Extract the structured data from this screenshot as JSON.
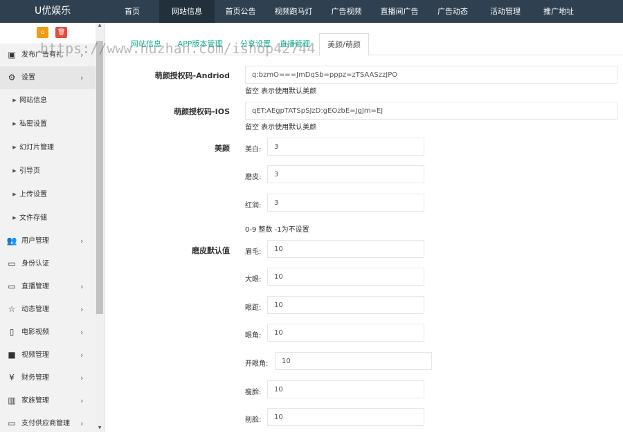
{
  "header": {
    "brand": "U优娱乐",
    "nav": [
      "首页",
      "网站信息",
      "首页公告",
      "视频跑马灯",
      "广告视频",
      "直播间广告",
      "广告动态",
      "活动管理",
      "推广地址"
    ]
  },
  "sidebar": {
    "items": [
      {
        "label": "发布广告有礼",
        "icon": "camera-icon",
        "glyph": "▣",
        "arrow": "›"
      },
      {
        "label": "设置",
        "icon": "gears-icon",
        "glyph": "⚙",
        "arrow": "›"
      },
      {
        "label": "网站信息",
        "icon": "caret-right-icon",
        "glyph": "▶"
      },
      {
        "label": "私密设置",
        "icon": "caret-right-icon",
        "glyph": "▶"
      },
      {
        "label": "幻灯片管理",
        "icon": "caret-right-icon",
        "glyph": "▶"
      },
      {
        "label": "引导页",
        "icon": "caret-right-icon",
        "glyph": "▶"
      },
      {
        "label": "上传设置",
        "icon": "caret-right-icon",
        "glyph": "▶"
      },
      {
        "label": "文件存储",
        "icon": "caret-right-icon",
        "glyph": "▶"
      },
      {
        "label": "用户管理",
        "icon": "users-icon",
        "glyph": "👥",
        "arrow": "›"
      },
      {
        "label": "身份认证",
        "icon": "monitor-icon",
        "glyph": "▭"
      },
      {
        "label": "直播管理",
        "icon": "monitor-icon",
        "glyph": "▭",
        "arrow": "›"
      },
      {
        "label": "动态管理",
        "icon": "star-icon",
        "glyph": "☆",
        "arrow": "›"
      },
      {
        "label": "电影视频",
        "icon": "phone-icon",
        "glyph": "▯",
        "arrow": "›"
      },
      {
        "label": "视频管理",
        "icon": "video-camera-icon",
        "glyph": "■",
        "arrow": "›"
      },
      {
        "label": "财务管理",
        "icon": "yen-icon",
        "glyph": "¥",
        "arrow": "›"
      },
      {
        "label": "家族管理",
        "icon": "bank-icon",
        "glyph": "▥",
        "arrow": "›"
      },
      {
        "label": "支付供应商管理",
        "icon": "monitor-icon",
        "glyph": "▭",
        "arrow": "›"
      }
    ],
    "tool_home_glyph": "⌂",
    "tool_delete_glyph": "🗑",
    "tool_home_color": "#f39c12",
    "tool_delete_color": "#e74c3c"
  },
  "tabs": [
    "网站信息",
    "APP版本管理",
    "分享设置",
    "直播管理",
    "美颜/萌颜"
  ],
  "watermark": "https://www.huzhan.com/ishop42744",
  "form": {
    "android": {
      "label": "萌颜授权码-Andriod",
      "value": "q:bzmO===JmDqSb=pppz=zTSAASzzJPO",
      "help": "留空 表示使用默认美颜"
    },
    "ios": {
      "label": "萌颜授权码-IOS",
      "value": "qET:AEgpTATSpSJzD:gEOzbE=JgJm=EJ",
      "help": "留空 表示使用默认美颜"
    },
    "beauty": {
      "label": "美颜",
      "fields": [
        {
          "label": "美白:",
          "value": "3"
        },
        {
          "label": "磨皮:",
          "value": "3"
        },
        {
          "label": "红润:",
          "value": "3"
        }
      ],
      "help": "0-9 整数 -1为不设置"
    },
    "skin_default": {
      "label": "磨皮默认值",
      "fields": [
        {
          "label": "眉毛:",
          "value": "10"
        },
        {
          "label": "大眼:",
          "value": "10"
        },
        {
          "label": "眼距:",
          "value": "10"
        },
        {
          "label": "眼角:",
          "value": "10"
        },
        {
          "label": "开眼角:",
          "value": "10"
        },
        {
          "label": "瘦脸:",
          "value": "10"
        },
        {
          "label": "削脸:",
          "value": "10"
        }
      ]
    }
  },
  "colors": {
    "topbar": "#2f4050",
    "accent": "#1ab394"
  }
}
